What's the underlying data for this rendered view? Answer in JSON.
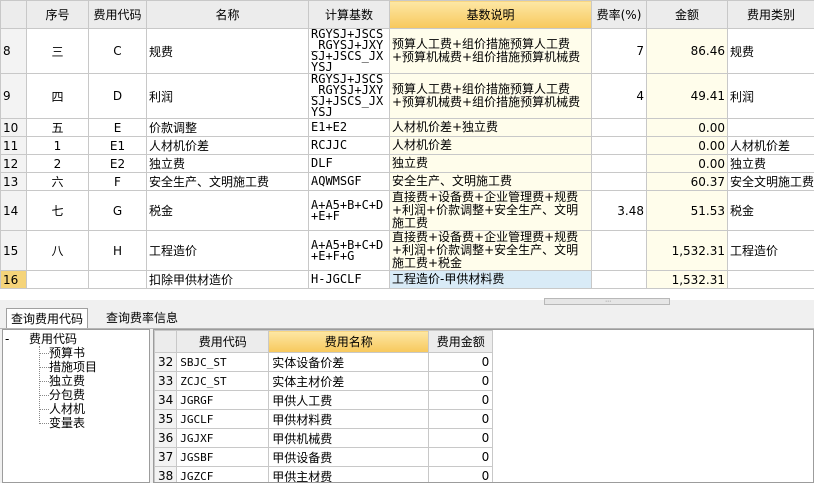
{
  "top_table": {
    "headers": [
      "",
      "序号",
      "费用代码",
      "名称",
      "计算基数",
      "基数说明",
      "费率(%)",
      "金额",
      "费用类别"
    ],
    "rows": [
      {
        "rownum": "8",
        "seq": "三",
        "code": "C",
        "name": "规费",
        "base": "RGYSJ+JSCS_RGYSJ+JXYSJ+JSCS_JXYSJ",
        "desc": "预算人工费+组价措施预算人工费+预算机械费+组价措施预算机械费",
        "rate": "7",
        "amount": "86.46",
        "category": "规费"
      },
      {
        "rownum": "9",
        "seq": "四",
        "code": "D",
        "name": "利润",
        "base": "RGYSJ+JSCS_RGYSJ+JXYSJ+JSCS_JXYSJ",
        "desc": "预算人工费+组价措施预算人工费+预算机械费+组价措施预算机械费",
        "rate": "4",
        "amount": "49.41",
        "category": "利润"
      },
      {
        "rownum": "10",
        "seq": "五",
        "code": "E",
        "name": "价款调整",
        "base": "E1+E2",
        "desc": "人材机价差+独立费",
        "rate": "",
        "amount": "0.00",
        "category": ""
      },
      {
        "rownum": "11",
        "seq": "1",
        "code": "E1",
        "name": "人材机价差",
        "base": "RCJJC",
        "desc": "人材机价差",
        "rate": "",
        "amount": "0.00",
        "category": "人材机价差"
      },
      {
        "rownum": "12",
        "seq": "2",
        "code": "E2",
        "name": "独立费",
        "base": "DLF",
        "desc": "独立费",
        "rate": "",
        "amount": "0.00",
        "category": "独立费"
      },
      {
        "rownum": "13",
        "seq": "六",
        "code": "F",
        "name": "安全生产、文明施工费",
        "base": "AQWMSGF",
        "desc": "安全生产、文明施工费",
        "rate": "",
        "amount": "60.37",
        "category": "安全文明施工费"
      },
      {
        "rownum": "14",
        "seq": "七",
        "code": "G",
        "name": "税金",
        "base": "A+A5+B+C+D+E+F",
        "desc": "直接费+设备费+企业管理费+规费+利润+价款调整+安全生产、文明施工费",
        "rate": "3.48",
        "amount": "51.53",
        "category": "税金"
      },
      {
        "rownum": "15",
        "seq": "八",
        "code": "H",
        "name": "工程造价",
        "base": "A+A5+B+C+D+E+F+G",
        "desc": "直接费+设备费+企业管理费+规费+利润+价款调整+安全生产、文明施工费+税金",
        "rate": "",
        "amount": "1,532.31",
        "category": "工程造价"
      },
      {
        "rownum": "16",
        "seq": "",
        "code": "",
        "name": "扣除甲供材造价",
        "base": "H-JGCLF",
        "desc": "工程造价-甲供材料费",
        "rate": "",
        "amount": "1,532.31",
        "category": ""
      }
    ]
  },
  "tabs": [
    {
      "label": "查询费用代码"
    },
    {
      "label": "查询费率信息"
    }
  ],
  "tree": {
    "root": "费用代码",
    "expander": "-",
    "children": [
      "预算书",
      "措施项目",
      "独立费",
      "分包费",
      "人材机",
      "变量表"
    ]
  },
  "bottom_table": {
    "headers": [
      "",
      "费用代码",
      "费用名称",
      "费用金额"
    ],
    "rows": [
      {
        "n": "32",
        "code": "SBJC_ST",
        "name": "实体设备价差",
        "amount": "0"
      },
      {
        "n": "33",
        "code": "ZCJC_ST",
        "name": "实体主材价差",
        "amount": "0"
      },
      {
        "n": "34",
        "code": "JGRGF",
        "name": "甲供人工费",
        "amount": "0"
      },
      {
        "n": "35",
        "code": "JGCLF",
        "name": "甲供材料费",
        "amount": "0"
      },
      {
        "n": "36",
        "code": "JGJXF",
        "name": "甲供机械费",
        "amount": "0"
      },
      {
        "n": "37",
        "code": "JGSBF",
        "name": "甲供设备费",
        "amount": "0"
      },
      {
        "n": "38",
        "code": "JGZCF",
        "name": "甲供主材费",
        "amount": "0"
      }
    ]
  }
}
